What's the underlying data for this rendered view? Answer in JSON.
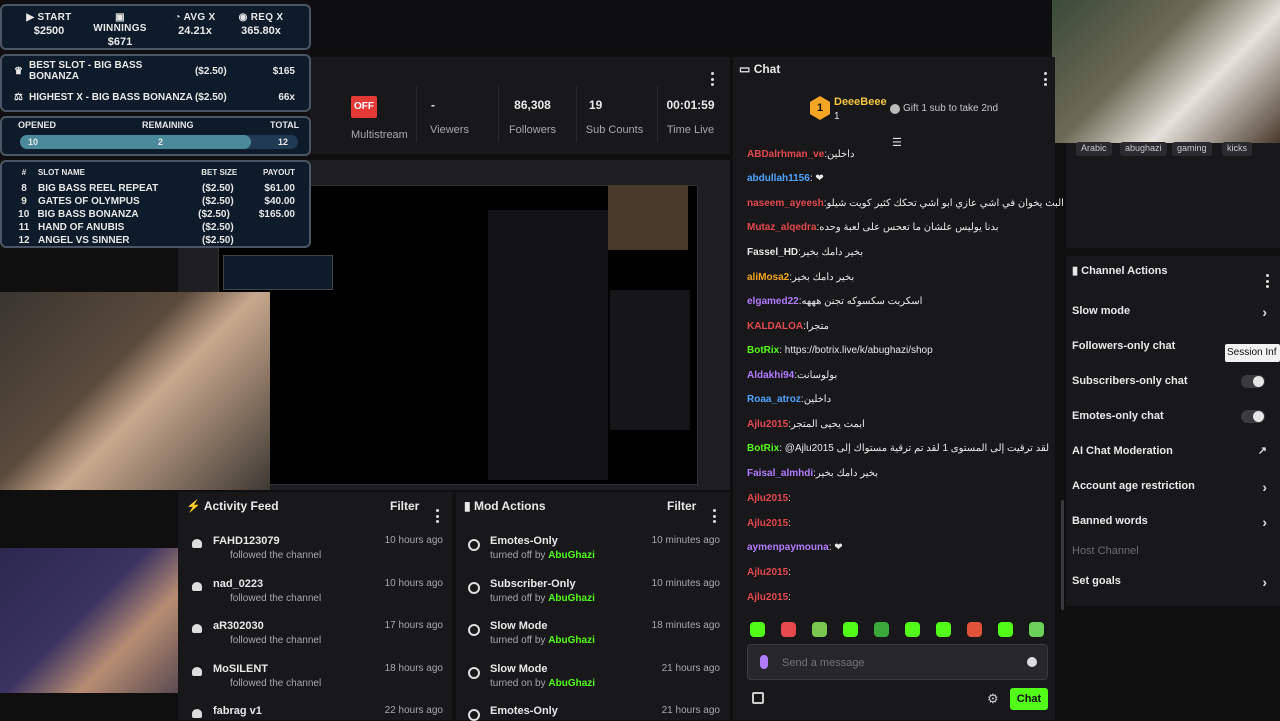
{
  "stats": {
    "start_label": "START",
    "start_value": "$2500",
    "winnings_label": "WINNINGS",
    "winnings_value": "$671",
    "avg_label": "AVG X",
    "avg_value": "24.21x",
    "req_label": "REQ X",
    "req_value": "365.80x"
  },
  "best": {
    "best_slot_label": "BEST SLOT - BIG BASS BONANZA",
    "best_slot_bet": "($2.50)",
    "best_slot_win": "$165",
    "highest_label": "HIGHEST X - BIG BASS BONANZA",
    "highest_bet": "($2.50)",
    "highest_x": "66x"
  },
  "progress": {
    "opened_label": "OPENED",
    "remaining_label": "REMAINING",
    "total_label": "TOTAL",
    "opened": "10",
    "remaining": "2",
    "total": "12",
    "fraction": 0.83
  },
  "slots": {
    "col_name": "SLOT NAME",
    "col_bet": "BET SIZE",
    "col_payout": "PAYOUT",
    "col_num": "#",
    "rows": [
      {
        "n": "8",
        "name": "BIG BASS REEL REPEAT",
        "bet": "($2.50)",
        "pay": "$61.00"
      },
      {
        "n": "9",
        "name": "GATES OF OLYMPUS",
        "bet": "($2.50)",
        "pay": "$40.00"
      },
      {
        "n": "10",
        "name": "BIG BASS BONANZA",
        "bet": "($2.50)",
        "pay": "$165.00"
      },
      {
        "n": "11",
        "name": "HAND OF ANUBIS",
        "bet": "($2.50)",
        "pay": ""
      },
      {
        "n": "12",
        "name": "ANGEL VS SINNER",
        "bet": "($2.50)",
        "pay": ""
      }
    ]
  },
  "stream_header": {
    "multistream_status": "OFF",
    "multistream_label": "Multistream",
    "viewers_value": "-",
    "viewers_label": "Viewers",
    "followers_value": "86,308",
    "followers_label": "Followers",
    "subs_value": "19",
    "subs_label": "Sub Counts",
    "time_value": "00:01:59",
    "time_label": "Time Live"
  },
  "chat": {
    "title": "Chat",
    "top_gifter_rank": "1",
    "top_gifter_name": "DeeeBeee",
    "top_gifter_count": "1",
    "gift_prompt": "Gift 1 sub to take 2nd",
    "messages": [
      {
        "user": "ABDalrhman_ve",
        "text": ":داخلين",
        "color": "#e5484d"
      },
      {
        "user": "abdullah1156",
        "text": ": ❤",
        "color": "#4fa3ff"
      },
      {
        "user": "naseem_ayeesh",
        "text": ":البث يخوان في اشي عازي ابو اشي تحكك كثير كويت شيلو",
        "color": "#e5484d"
      },
      {
        "user": "Mutaz_alqedra",
        "text": ":بدنا يوليس علشان ما تعحس على لعبة وحده",
        "color": "#e5484d"
      },
      {
        "user": "Fassel_HD",
        "text": ":بخير دامك بخير",
        "color": "#e8e8e8"
      },
      {
        "user": "aliMosa2",
        "text": ":بخير دامك بخير",
        "color": "#f5a524"
      },
      {
        "user": "elgamed22",
        "text": ":اسكربت سكسوكه تجنن هههه",
        "color": "#b17cff"
      },
      {
        "user": "KALDALOA",
        "text": ":متجرا",
        "color": "#e5484d"
      },
      {
        "user": "BotRix",
        "text": ": https://botrix.live/k/abughazi/shop",
        "color": "#53fc18"
      },
      {
        "user": "Aldakhi94",
        "text": ":بولوسانت",
        "color": "#b17cff"
      },
      {
        "user": "Roaa_atroz",
        "text": ":داخلين",
        "color": "#4fa3ff"
      },
      {
        "user": "Ajlu2015",
        "text": ":ابمت يحيى المتجر",
        "color": "#e5484d"
      },
      {
        "user": "BotRix",
        "text": ": @Ajlu2015 لقد ترقيت إلى المستوى 1 لقد تم ترقية مستواك إلى",
        "color": "#53fc18"
      },
      {
        "user": "Faisal_almhdi",
        "text": ":بخير دامك بخير",
        "color": "#b17cff"
      },
      {
        "user": "Ajlu2015",
        "text": ":",
        "color": "#e5484d"
      },
      {
        "user": "Ajlu2015",
        "text": ":",
        "color": "#e5484d"
      },
      {
        "user": "aymenpaymouna",
        "text": ": ❤",
        "color": "#b17cff"
      },
      {
        "user": "Ajlu2015",
        "text": ":",
        "color": "#e5484d"
      },
      {
        "user": "Ajlu2015",
        "text": ":",
        "color": "#e5484d"
      }
    ],
    "input_placeholder": "Send a message",
    "send_label": "Chat"
  },
  "activity": {
    "title": "Activity Feed",
    "filter": "Filter",
    "items": [
      {
        "name": "FAHD123079",
        "action": "followed the channel",
        "time": "10 hours ago"
      },
      {
        "name": "nad_0223",
        "action": "followed the channel",
        "time": "10 hours ago"
      },
      {
        "name": "aR302030",
        "action": "followed the channel",
        "time": "17 hours ago"
      },
      {
        "name": "MoSILENT",
        "action": "followed the channel",
        "time": "18 hours ago"
      },
      {
        "name": "fabrag v1",
        "action": "",
        "time": "22 hours ago"
      }
    ]
  },
  "mod": {
    "title": "Mod Actions",
    "filter": "Filter",
    "items": [
      {
        "name": "Emotes-Only",
        "action": "turned off by",
        "by": "AbuGhazi",
        "time": "10 minutes ago"
      },
      {
        "name": "Subscriber-Only",
        "action": "turned off by",
        "by": "AbuGhazi",
        "time": "10 minutes ago"
      },
      {
        "name": "Slow Mode",
        "action": "turned off by",
        "by": "AbuGhazi",
        "time": "18 minutes ago"
      },
      {
        "name": "Slow Mode",
        "action": "turned on by",
        "by": "AbuGhazi",
        "time": "21 hours ago"
      },
      {
        "name": "Emotes-Only",
        "action": "",
        "by": "",
        "time": "21 hours ago"
      }
    ]
  },
  "tags": [
    "Arabic",
    "abughazi",
    "gaming",
    "kicks"
  ],
  "channel_actions": {
    "title": "Channel Actions",
    "slow_mode": "Slow mode",
    "followers_only": "Followers-only chat",
    "session_info": "Session Inf",
    "subscribers_only": "Subscribers-only chat",
    "emotes_only": "Emotes-only chat",
    "ai_moderation": "AI Chat Moderation",
    "age_restriction": "Account age restriction",
    "banned_words": "Banned words",
    "host_channel": "Host Channel",
    "set_goals": "Set goals"
  },
  "colors": {
    "accent": "#53fc18",
    "danger": "#e53935",
    "panel": "#18181b"
  }
}
